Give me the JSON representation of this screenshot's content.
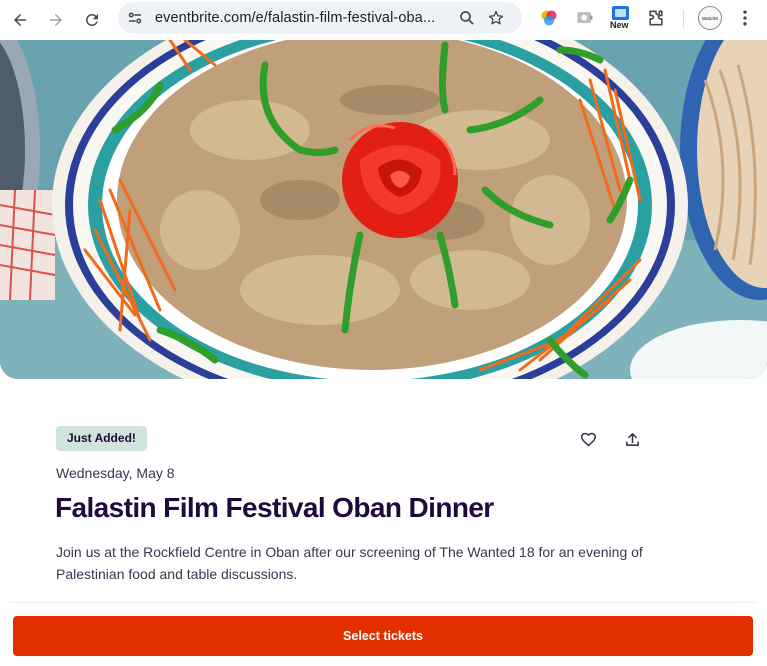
{
  "browser": {
    "url": "eventbrite.com/e/falastin-film-festival-oba...",
    "extension_new_label": "New",
    "profile_avatar_text": "WatchIt"
  },
  "event": {
    "badge": "Just Added!",
    "date": "Wednesday, May 8",
    "title": "Falastin Film Festival Oban Dinner",
    "summary": "Join us at the Rockfield Centre in Oban after our screening of The Wanted 18 for an evening of Palestinian food and table discussions.",
    "cta_label": "Select tickets"
  },
  "icons": {
    "like": "heart-icon",
    "share": "share-icon"
  },
  "colors": {
    "cta_background": "#e12f00",
    "badge_background": "#cfe4dc",
    "title_text": "#1e0a3c"
  }
}
